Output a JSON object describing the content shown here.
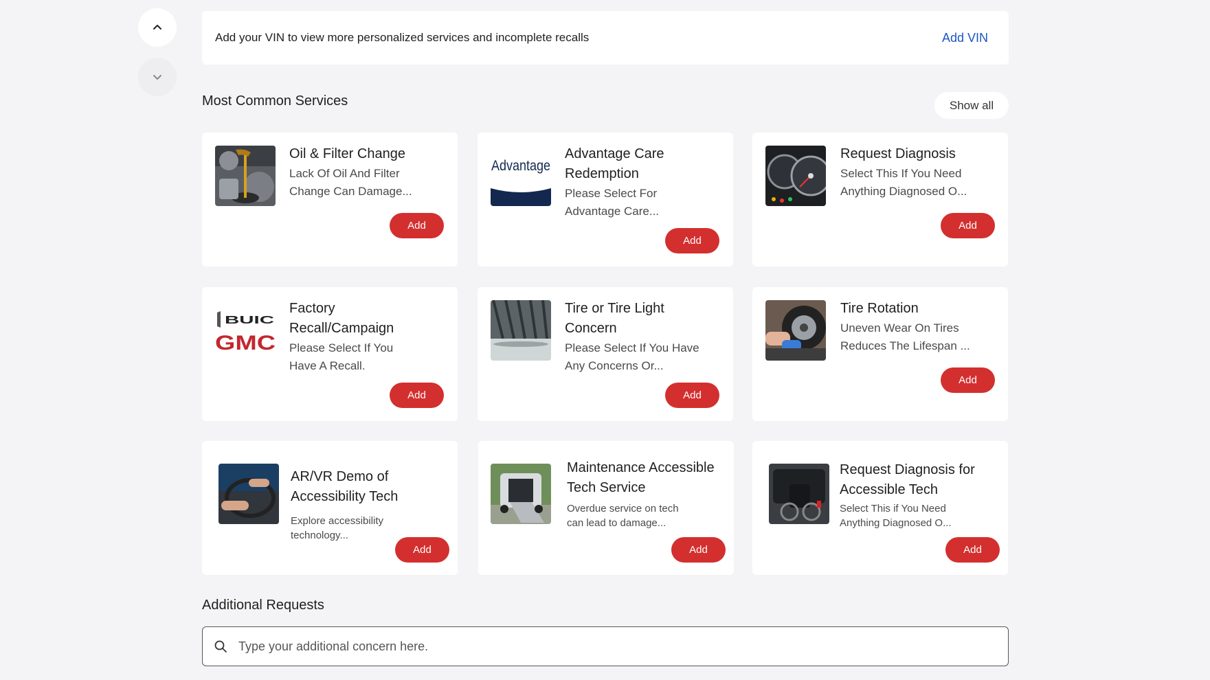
{
  "vin_banner": {
    "message": "Add your VIN to view more personalized services and incomplete recalls",
    "action_label": "Add VIN"
  },
  "services_section": {
    "title": "Most Common Services",
    "show_all_label": "Show all",
    "add_label": "Add",
    "cards": [
      {
        "title": "Oil & Filter Change",
        "description": "Lack Of Oil And Filter Change Can Damage...",
        "thumbnail": "oil-pour-engine"
      },
      {
        "title": "Advantage Care Redemption",
        "description": "Please Select For Advantage Care...",
        "thumbnail": "advantage-logo"
      },
      {
        "title": "Request Diagnosis",
        "description": "Select This If You Need Anything Diagnosed O...",
        "thumbnail": "dashboard-gauges"
      },
      {
        "title": "Factory Recall/Campaign",
        "description": "Please Select If You Have A Recall.",
        "thumbnail": "buick-gmc-logo"
      },
      {
        "title": "Tire or Tire Light Concern",
        "description": "Please Select If You Have Any Concerns Or...",
        "thumbnail": "tire-tread"
      },
      {
        "title": "Tire Rotation",
        "description": "Uneven Wear On Tires Reduces The Lifespan ...",
        "thumbnail": "tire-mechanic"
      },
      {
        "title": "AR/VR Demo of Accessibility Tech",
        "description": "Explore accessibility technology...",
        "thumbnail": "steering-hand-controls"
      },
      {
        "title": "Maintenance Accessible Tech Service",
        "description": "Overdue service on tech can lead to damage...",
        "thumbnail": "van-ramp"
      },
      {
        "title": "Request Diagnosis for Accessible Tech",
        "description": "Select This if You Need Anything Diagnosed O...",
        "thumbnail": "wheelchair-vehicle"
      }
    ]
  },
  "additional_requests": {
    "title": "Additional Requests",
    "placeholder": "Type your additional concern here."
  },
  "brand_text": {
    "advantage": "Advantage",
    "buick": "BUIC",
    "gmc": "GMC"
  },
  "colors": {
    "accent_red": "#d32f2f",
    "link_blue": "#1a56c4",
    "page_bg": "#f4f4f6",
    "advantage_navy": "#12284f"
  }
}
